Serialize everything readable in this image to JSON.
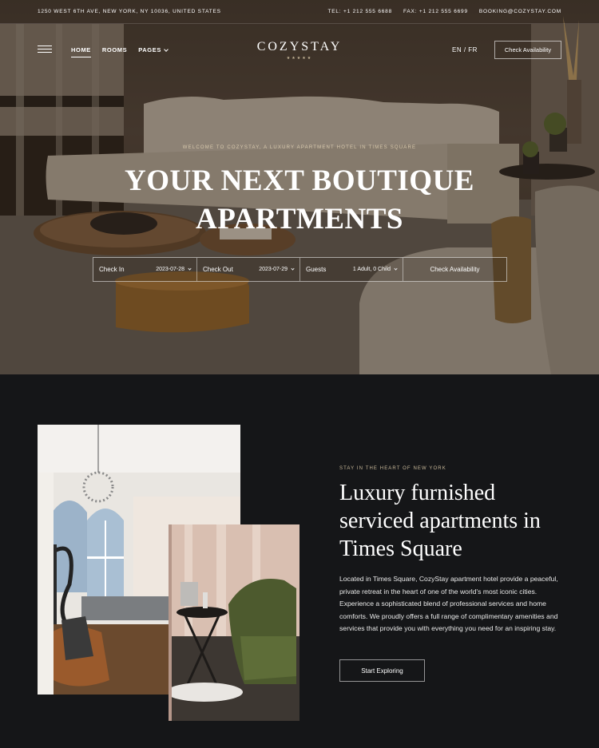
{
  "topbar": {
    "address": "1250 West 6th Ave, New York, NY 10036, United States",
    "tel": "Tel: +1 212 555 6688",
    "fax": "Fax: +1 212 555 6699",
    "email": "booking@cozystay.com"
  },
  "nav": {
    "items": [
      "Home",
      "Rooms",
      "Pages"
    ],
    "logo": "COZYSTAY",
    "stars": "★★★★★",
    "lang": "EN / FR",
    "cta": "Check Availability"
  },
  "hero": {
    "eyebrow": "Welcome to CozyStay, a luxury apartment hotel in Times Square",
    "title_line1": "Your Next Boutique",
    "title_line2": "Apartments"
  },
  "booking": {
    "checkin_label": "Check In",
    "checkin_value": "2023-07-28",
    "checkout_label": "Check Out",
    "checkout_value": "2023-07-29",
    "guests_label": "Guests",
    "guests_value": "1 Adult, 0 Child",
    "submit": "Check Availability"
  },
  "about": {
    "kicker": "Stay in the heart of New York",
    "heading": "Luxury furnished serviced apartments in Times Square",
    "body": "Located in Times Square, CozyStay apartment hotel provide a peaceful, private retreat in the heart of one of the world's most iconic cities. Experience a sophisticated blend of professional services and home comforts. We proudly offers a full range of complimentary amenities and services that provide you with everything you need for an inspiring stay.",
    "cta": "Start Exploring"
  }
}
